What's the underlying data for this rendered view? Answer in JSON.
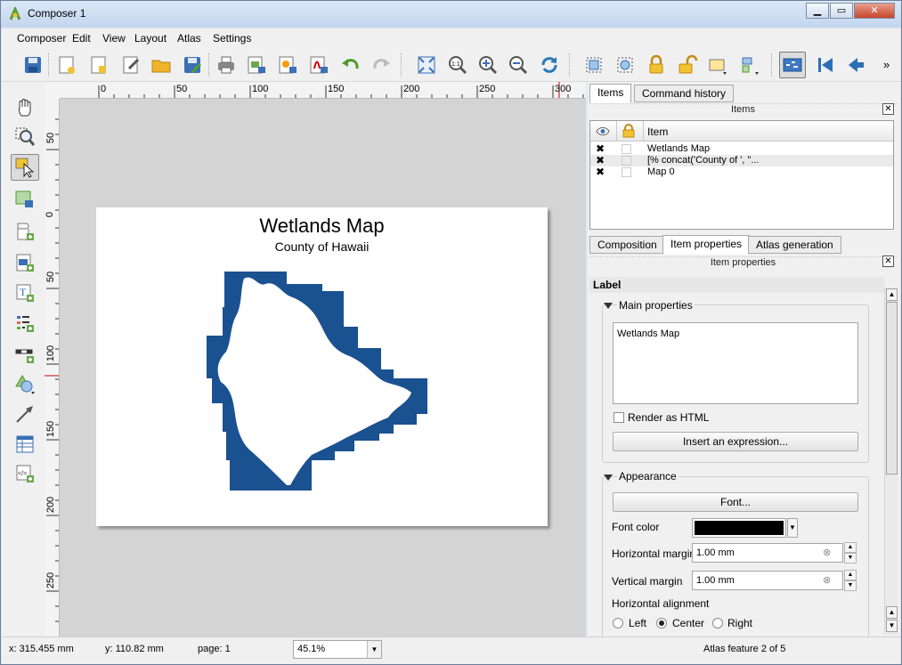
{
  "window": {
    "title": "Composer 1"
  },
  "menu": [
    "Composer",
    "Edit",
    "View",
    "Layout",
    "Atlas",
    "Settings"
  ],
  "toolbar": {
    "icons": [
      "save-icon",
      "new-composer-icon",
      "duplicate-composer-icon",
      "composer-manager-icon",
      "open-template-icon",
      "save-template-icon",
      "print-icon",
      "export-image-icon",
      "export-svg-icon",
      "export-pdf-icon",
      "undo-icon",
      "redo-icon",
      "zoom-full-icon",
      "zoom-100-icon",
      "zoom-in-icon",
      "zoom-out-icon",
      "refresh-icon",
      "group-icon",
      "ungroup-icon",
      "lock-icon",
      "unlock-icon",
      "raise-items-icon",
      "align-items-icon",
      "atlas-preview-icon",
      "first-feature-icon",
      "previous-feature-icon"
    ],
    "overflow": "»"
  },
  "left_tools": [
    "pan-icon",
    "zoom-tool-icon",
    "select-move-icon",
    "move-content-icon",
    "add-map-icon",
    "add-image-icon",
    "add-label-icon",
    "add-legend-icon",
    "add-scalebar-icon",
    "add-shape-icon",
    "add-arrow-icon",
    "add-table-icon",
    "add-html-icon"
  ],
  "rulers": {
    "top_labels": [
      "0",
      "50",
      "100",
      "150",
      "200",
      "250",
      "300"
    ],
    "left_labels": [
      "50",
      "0",
      "50",
      "100",
      "150",
      "200",
      "250"
    ]
  },
  "paper": {
    "title": "Wetlands Map",
    "subtitle": "County of Hawaii",
    "map_color": "#1a5190"
  },
  "dock": {
    "tabs_top": [
      "Items",
      "Command history"
    ],
    "items_header": "Items",
    "tree_header": "Item",
    "items": [
      {
        "visible": "✖",
        "name": "Wetlands Map"
      },
      {
        "visible": "✖",
        "name": "[% concat('County of ', \"..."
      },
      {
        "visible": "✖",
        "name": "Map 0"
      }
    ],
    "tabs_bottom": [
      "Composition",
      "Item properties",
      "Atlas generation"
    ],
    "props_header": "Item properties",
    "props_title": "Label",
    "main_properties": {
      "label": "Main properties",
      "text": "Wetlands Map",
      "render_html": "Render as HTML",
      "insert_expression": "Insert an expression..."
    },
    "appearance": {
      "label": "Appearance",
      "font_button": "Font...",
      "font_color_label": "Font color",
      "font_color": "#000000",
      "h_margin_label": "Horizontal margin",
      "h_margin": "1.00 mm",
      "v_margin_label": "Vertical margin",
      "v_margin": "1.00 mm",
      "h_align_label": "Horizontal alignment",
      "align_options": [
        "Left",
        "Center",
        "Right"
      ],
      "align_selected": "Center"
    }
  },
  "status": {
    "x": "x: 315.455 mm",
    "y": "y: 110.82 mm",
    "page": "page: 1",
    "zoom": "45.1%",
    "atlas": "Atlas feature 2 of 5"
  }
}
